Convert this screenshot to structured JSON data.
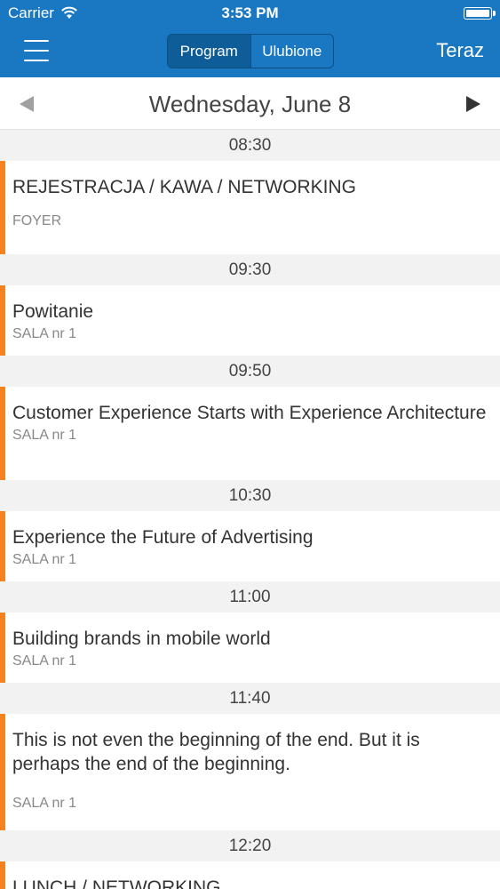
{
  "status_bar": {
    "carrier": "Carrier",
    "time": "3:53 PM"
  },
  "nav": {
    "segments": [
      "Program",
      "Ulubione"
    ],
    "active_segment": "Program",
    "right_action": "Teraz"
  },
  "date_header": {
    "date": "Wednesday, June 8"
  },
  "schedule": [
    {
      "time": "08:30",
      "title": "REJESTRACJA / KAWA / NETWORKING",
      "room": "FOYER"
    },
    {
      "time": "09:30",
      "title": "Powitanie",
      "room": "SALA nr 1"
    },
    {
      "time": "09:50",
      "title": "Customer Experience Starts with Experience Architecture",
      "room": "SALA nr 1"
    },
    {
      "time": "10:30",
      "title": "Experience the Future of Advertising",
      "room": "SALA nr 1"
    },
    {
      "time": "11:00",
      "title": "Building brands in mobile world",
      "room": "SALA nr 1"
    },
    {
      "time": "11:40",
      "title": "This is not even the beginning of the end. But it is perhaps the end of the beginning.",
      "room": "SALA nr 1"
    },
    {
      "time": "12:20",
      "title": "LUNCH / NETWORKING",
      "room": ""
    }
  ],
  "colors": {
    "primary": "#1a78c2",
    "accent": "#f58220"
  },
  "icons": {
    "menu": "hamburger-menu-icon",
    "prev": "arrow-left-icon",
    "next": "arrow-right-icon",
    "wifi": "wifi-icon",
    "battery": "battery-icon"
  }
}
